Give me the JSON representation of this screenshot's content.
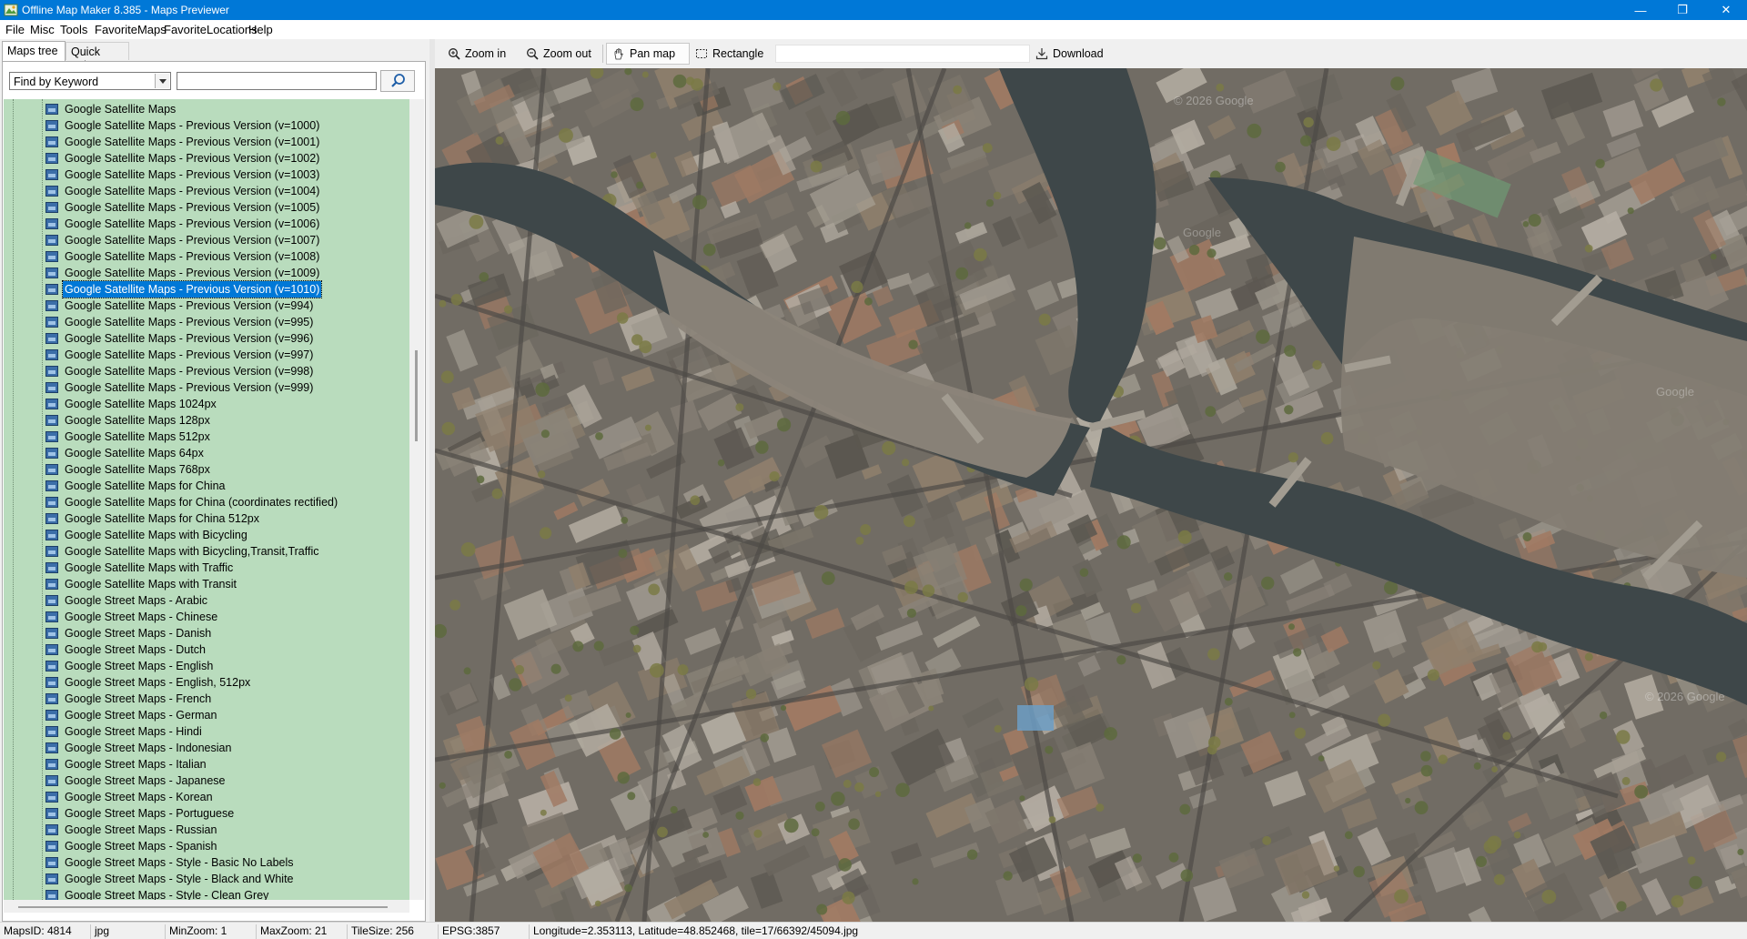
{
  "window": {
    "title": "Offline Map Maker 8.385 - Maps Previewer",
    "controls": {
      "minimize": "—",
      "maximize": "❐",
      "close": "✕"
    }
  },
  "menu": [
    "File",
    "Misc",
    "Tools",
    "FavoriteMaps",
    "FavoriteLocations",
    "Help"
  ],
  "left_panel": {
    "tabs": [
      "Maps tree",
      "Quick goto"
    ],
    "active_tab": "Maps tree",
    "find_mode": "Find by Keyword",
    "search_value": "",
    "selected_item": "Google Satellite Maps - Previous Version (v=1010)",
    "tree_items": [
      "Google Satellite Maps",
      "Google Satellite Maps - Previous Version (v=1000)",
      "Google Satellite Maps - Previous Version (v=1001)",
      "Google Satellite Maps - Previous Version (v=1002)",
      "Google Satellite Maps - Previous Version (v=1003)",
      "Google Satellite Maps - Previous Version (v=1004)",
      "Google Satellite Maps - Previous Version (v=1005)",
      "Google Satellite Maps - Previous Version (v=1006)",
      "Google Satellite Maps - Previous Version (v=1007)",
      "Google Satellite Maps - Previous Version (v=1008)",
      "Google Satellite Maps - Previous Version (v=1009)",
      "Google Satellite Maps - Previous Version (v=1010)",
      "Google Satellite Maps - Previous Version (v=994)",
      "Google Satellite Maps - Previous Version (v=995)",
      "Google Satellite Maps - Previous Version (v=996)",
      "Google Satellite Maps - Previous Version (v=997)",
      "Google Satellite Maps - Previous Version (v=998)",
      "Google Satellite Maps - Previous Version (v=999)",
      "Google Satellite Maps 1024px",
      "Google Satellite Maps 128px",
      "Google Satellite Maps 512px",
      "Google Satellite Maps 64px",
      "Google Satellite Maps 768px",
      "Google Satellite Maps for China",
      "Google Satellite Maps for China (coordinates rectified)",
      "Google Satellite Maps for China 512px",
      "Google Satellite Maps with Bicycling",
      "Google Satellite Maps with Bicycling,Transit,Traffic",
      "Google Satellite Maps with Traffic",
      "Google Satellite Maps with Transit",
      "Google Street Maps - Arabic",
      "Google Street Maps - Chinese",
      "Google Street Maps - Danish",
      "Google Street Maps - Dutch",
      "Google Street Maps - English",
      "Google Street Maps - English, 512px",
      "Google Street Maps - French",
      "Google Street Maps - German",
      "Google Street Maps - Hindi",
      "Google Street Maps - Indonesian",
      "Google Street Maps - Italian",
      "Google Street Maps - Japanese",
      "Google Street Maps - Korean",
      "Google Street Maps - Portuguese",
      "Google Street Maps - Russian",
      "Google Street Maps - Spanish",
      "Google Street Maps - Style - Basic No Labels",
      "Google Street Maps - Style - Black and White",
      "Google Street Maps - Style - Clean Grey"
    ]
  },
  "toolbar": {
    "zoom_in": "Zoom in",
    "zoom_out": "Zoom out",
    "pan_map": "Pan map",
    "rectangle": "Rectangle",
    "download": "Download",
    "active_tool": "Pan map"
  },
  "map": {
    "watermarks": [
      "© 2026 Google",
      "Google",
      "© 2026 Google",
      "Google"
    ]
  },
  "status": {
    "maps_id": "MapsID: 4814",
    "format": "jpg",
    "min_zoom": "MinZoom: 1",
    "max_zoom": "MaxZoom: 21",
    "tile_size": "TileSize: 256",
    "epsg": "EPSG:3857",
    "coords": "Longitude=2.353113, Latitude=48.852468, tile=17/66392/45094.jpg"
  },
  "colors": {
    "titlebar": "#0078d7",
    "tree_background": "#b9dcbd",
    "selection": "#0078d7",
    "river": "#3f4a4c"
  }
}
